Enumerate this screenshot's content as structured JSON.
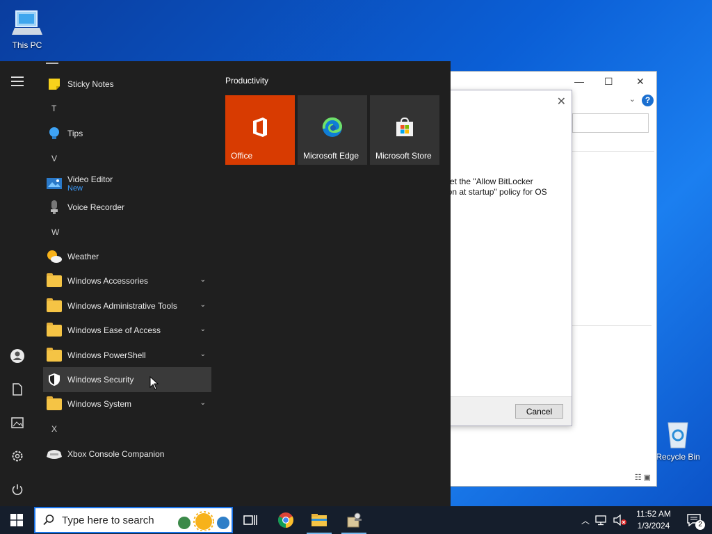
{
  "desktop": {
    "this_pc_label": "This PC",
    "recycle_bin_label": "Recycle Bin"
  },
  "dialog": {
    "message": "set the \"Allow BitLocker\nion at startup\" policy for OS",
    "cancel_label": "Cancel"
  },
  "start_menu": {
    "apps": [
      {
        "type": "app",
        "label": "Sticky Notes",
        "icon": "sticky-notes-icon"
      },
      {
        "type": "letter",
        "label": "T"
      },
      {
        "type": "app",
        "label": "Tips",
        "icon": "tips-icon"
      },
      {
        "type": "letter",
        "label": "V"
      },
      {
        "type": "app",
        "label": "Video Editor",
        "sub": "New",
        "icon": "video-editor-icon"
      },
      {
        "type": "app",
        "label": "Voice Recorder",
        "icon": "voice-recorder-icon"
      },
      {
        "type": "letter",
        "label": "W"
      },
      {
        "type": "app",
        "label": "Weather",
        "icon": "weather-icon"
      },
      {
        "type": "folder",
        "label": "Windows Accessories"
      },
      {
        "type": "folder",
        "label": "Windows Administrative Tools"
      },
      {
        "type": "folder",
        "label": "Windows Ease of Access"
      },
      {
        "type": "folder",
        "label": "Windows PowerShell"
      },
      {
        "type": "app",
        "label": "Windows Security",
        "icon": "shield-icon",
        "hover": true
      },
      {
        "type": "folder",
        "label": "Windows System"
      },
      {
        "type": "letter",
        "label": "X"
      },
      {
        "type": "app",
        "label": "Xbox Console Companion",
        "icon": "xbox-icon"
      }
    ],
    "tiles_group_title": "Productivity",
    "tiles": [
      {
        "label": "Office",
        "icon": "office-icon",
        "color": "#d83b01"
      },
      {
        "label": "Microsoft Edge",
        "icon": "edge-icon",
        "color": "#333333"
      },
      {
        "label": "Microsoft Store",
        "icon": "store-icon",
        "color": "#333333"
      }
    ]
  },
  "taskbar": {
    "search_placeholder": "Type here to search",
    "time": "11:52 AM",
    "date": "1/3/2024",
    "notification_count": "2"
  }
}
